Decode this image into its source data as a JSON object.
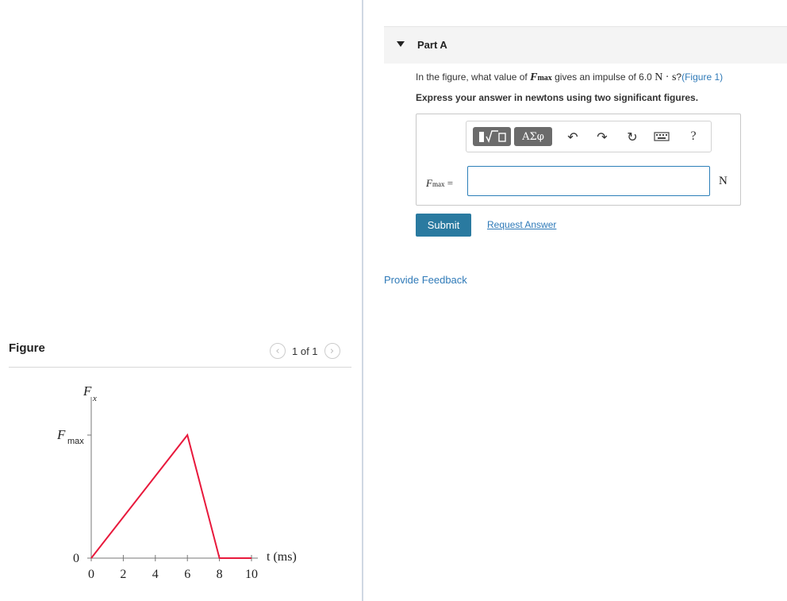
{
  "figure_panel": {
    "title": "Figure",
    "pager": {
      "prev_icon": "chevron-left-icon",
      "text": "1 of 1",
      "next_icon": "chevron-right-icon"
    },
    "graph": {
      "y_axis_label": "F",
      "y_axis_sub": "x",
      "fmax_label": "F",
      "fmax_sub": "max",
      "origin_label": "0",
      "x_axis_label": "t (ms)",
      "x_ticks": [
        "0",
        "2",
        "4",
        "6",
        "8",
        "10"
      ],
      "curve_color": "#e8193c",
      "points": [
        {
          "t": 0,
          "f": 0
        },
        {
          "t": 6,
          "f": 1
        },
        {
          "t": 8,
          "f": 0
        },
        {
          "t": 10,
          "f": 0
        }
      ]
    }
  },
  "question_panel": {
    "part_title": "Part A",
    "question_pre": "In the figure, what value of ",
    "question_var": "F",
    "question_var_sub": "max",
    "question_mid": " gives an impulse of 6.0 ",
    "question_unit": "N · s",
    "question_post": "?",
    "figure_link": "(Figure 1)",
    "instruction": "Express your answer in newtons using two significant figures.",
    "toolbar": {
      "templates_icon": "templates-icon",
      "greek_label": "ΑΣφ",
      "undo_icon": "undo-icon",
      "redo_icon": "redo-icon",
      "reset_icon": "reset-icon",
      "keyboard_icon": "keyboard-icon",
      "help_label": "?"
    },
    "answer_label": "F",
    "answer_label_sub": "max",
    "answer_equals": "=",
    "answer_value": "",
    "answer_unit": "N",
    "submit_label": "Submit",
    "request_answer_label": "Request Answer",
    "feedback_label": "Provide Feedback"
  },
  "colors": {
    "accent": "#2a7aa0",
    "link": "#2f7ab8",
    "curve": "#e8193c"
  }
}
